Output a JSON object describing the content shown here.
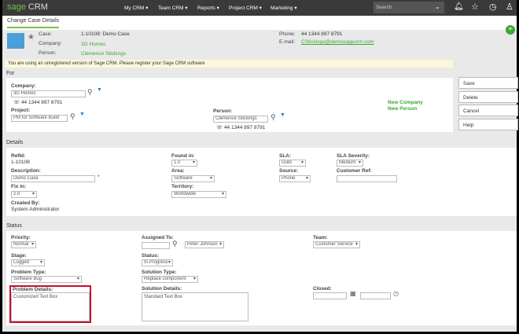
{
  "nav": {
    "logo_brand": "sage",
    "logo_product": "CRM",
    "menus": [
      "My CRM ▾",
      "Team CRM ▾",
      "Reports ▾",
      "Project CRM ▾",
      "Marketing ▾"
    ],
    "search_placeholder": "Search"
  },
  "tab": "Change Case Details",
  "header": {
    "case_label": "Case:",
    "case_value": "1-10108: Demo Case",
    "company_label": "Company:",
    "company_value": "3G Homes",
    "person_label": "Person:",
    "person_value": "Clemence Stickings",
    "phone_label": "Phone:",
    "phone_value": "44 1344 897 8791",
    "email_label": "E-mail:",
    "email_value": "CStickings@demosagecrm.com"
  },
  "banner": "You are using an unregistered version of Sage CRM. Please register your Sage CRM software",
  "for": {
    "title": "For",
    "company_label": "Company:",
    "company_value": "3G Homes",
    "company_phone": "44 1344 897 8791",
    "project_label": "Project:",
    "project_value": "PM for Software Build",
    "person_label": "Person:",
    "person_value": "Clemence Stickings",
    "person_phone": "44 1344 897 8791",
    "new_company": "New Company",
    "new_person": "New Person"
  },
  "buttons": {
    "save": "Save",
    "delete": "Delete",
    "cancel": "Cancel",
    "help": "Help"
  },
  "details": {
    "title": "Details",
    "refid_label": "RefId:",
    "refid_value": "1-10108",
    "found_label": "Found in:",
    "found_value": "1.0",
    "sla_label": "SLA:",
    "sla_value": "Gold",
    "severity_label": "SLA Severity:",
    "severity_value": "Medium",
    "desc_label": "Description:",
    "desc_value": "Demo Case",
    "required_mark": "*",
    "area_label": "Area:",
    "area_value": "Software",
    "source_label": "Source:",
    "source_value": "Phone",
    "custref_label": "Customer Ref:",
    "custref_value": "",
    "fixin_label": "Fix in:",
    "fixin_value": "2.0",
    "territory_label": "Territory:",
    "territory_value": "Worldwide",
    "created_label": "Created By:",
    "created_value": "System Administrator"
  },
  "status": {
    "title": "Status",
    "priority_label": "Priority:",
    "priority_value": "Normal",
    "assigned_label": "Assigned To:",
    "assigned_value": "Peter Johnson",
    "team_label": "Team:",
    "team_value": "Customer Service",
    "stage_label": "Stage:",
    "stage_value": "Logged",
    "status_label": "Status:",
    "status_value": "In Progress",
    "ptype_label": "Problem Type:",
    "ptype_value": "Software Bug",
    "stype_label": "Solution Type:",
    "stype_value": "Replace component",
    "pdetails_label": "Problem Details:",
    "pdetails_value": "Customized Text Box",
    "sdetails_label": "Solution Details:",
    "sdetails_value": "Standard Text Box",
    "closed_label": "Closed:"
  },
  "colors": {
    "accent": "#7ac143",
    "highlight": "#c8102e",
    "nav": "#3a3a3a"
  }
}
